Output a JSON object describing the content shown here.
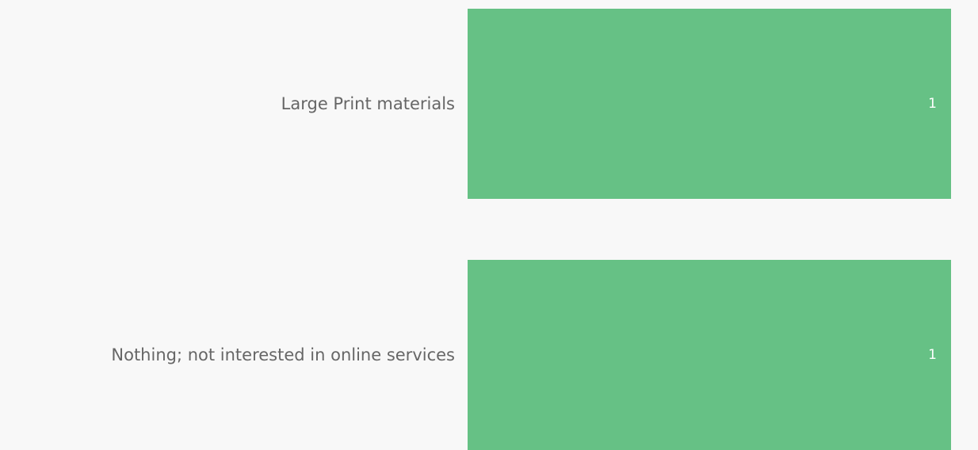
{
  "chart_data": {
    "type": "bar",
    "orientation": "horizontal",
    "categories": [
      "Large Print materials",
      "Nothing; not interested in online services"
    ],
    "values": [
      1,
      1
    ],
    "data_labels": [
      "1",
      "1"
    ],
    "xlim": [
      0,
      1
    ],
    "grid": false,
    "bar_color": "#66c185",
    "label_color": "#666666",
    "value_label_color": "#ffffff",
    "background": "#f8f8f8"
  }
}
